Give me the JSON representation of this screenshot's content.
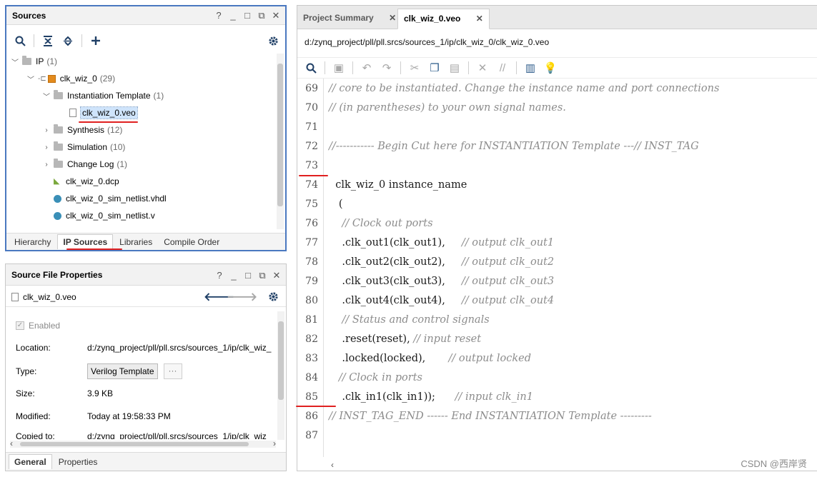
{
  "sources_panel": {
    "title": "Sources",
    "window_buttons": [
      "?",
      "_",
      "□",
      "⧉",
      "✕"
    ],
    "toolbar": [
      "search-icon",
      "collapse-all-icon",
      "expand-all-icon",
      "add-icon",
      "gear-icon"
    ],
    "tree": [
      {
        "label": "IP",
        "count": "(1)"
      },
      {
        "label": "clk_wiz_0",
        "count": "(29)"
      },
      {
        "label": "Instantiation Template",
        "count": "(1)"
      },
      {
        "label": "clk_wiz_0.veo",
        "count": ""
      },
      {
        "label": "Synthesis",
        "count": "(12)"
      },
      {
        "label": "Simulation",
        "count": "(10)"
      },
      {
        "label": "Change Log",
        "count": "(1)"
      },
      {
        "label": "clk_wiz_0.dcp",
        "count": ""
      },
      {
        "label": "clk_wiz_0_sim_netlist.vhdl",
        "count": ""
      },
      {
        "label": "clk_wiz_0_sim_netlist.v",
        "count": ""
      }
    ],
    "tabs": [
      "Hierarchy",
      "IP Sources",
      "Libraries",
      "Compile Order"
    ]
  },
  "properties_panel": {
    "title": "Source File Properties",
    "window_buttons": [
      "?",
      "_",
      "□",
      "⧉",
      "✕"
    ],
    "file": "clk_wiz_0.veo",
    "enabled_label": "Enabled",
    "rows": [
      {
        "key": "Location:",
        "value": "d:/zynq_project/pll/pll.srcs/sources_1/ip/clk_wiz_"
      },
      {
        "key": "Type:",
        "value": "Verilog Template"
      },
      {
        "key": "Size:",
        "value": "3.9 KB"
      },
      {
        "key": "Modified:",
        "value": "Today at 19:58:33 PM"
      },
      {
        "key": "Copied to:",
        "value": "d:/zynq_project/pll/pll.srcs/sources_1/ip/clk_wiz"
      }
    ],
    "more_button": "···",
    "tabs": [
      "General",
      "Properties"
    ]
  },
  "editor": {
    "tabs": [
      {
        "label": "Project Summary",
        "close": "✕"
      },
      {
        "label": "clk_wiz_0.veo",
        "close": "✕"
      }
    ],
    "path": "d:/zynq_project/pll/pll.srcs/sources_1/ip/clk_wiz_0/clk_wiz_0.veo",
    "lines": [
      {
        "n": "69",
        "code": "",
        "comment": "// core to be instantiated. Change the instance name and port connections"
      },
      {
        "n": "70",
        "code": "",
        "comment": "// (in parentheses) to your own signal names."
      },
      {
        "n": "71",
        "code": "",
        "comment": ""
      },
      {
        "n": "72",
        "code": "",
        "comment": "//----------- Begin Cut here for INSTANTIATION Template ---// INST_TAG"
      },
      {
        "n": "73",
        "code": "",
        "comment": ""
      },
      {
        "n": "74",
        "code": "  clk_wiz_0 instance_name",
        "comment": ""
      },
      {
        "n": "75",
        "code": "   (",
        "comment": ""
      },
      {
        "n": "76",
        "code": "    ",
        "comment": "// Clock out ports"
      },
      {
        "n": "77",
        "code": "    .clk_out1(clk_out1),     ",
        "comment": "// output clk_out1"
      },
      {
        "n": "78",
        "code": "    .clk_out2(clk_out2),     ",
        "comment": "// output clk_out2"
      },
      {
        "n": "79",
        "code": "    .clk_out3(clk_out3),     ",
        "comment": "// output clk_out3"
      },
      {
        "n": "80",
        "code": "    .clk_out4(clk_out4),     ",
        "comment": "// output clk_out4"
      },
      {
        "n": "81",
        "code": "    ",
        "comment": "// Status and control signals"
      },
      {
        "n": "82",
        "code": "    .reset(reset), ",
        "comment": "// input reset"
      },
      {
        "n": "83",
        "code": "    .locked(locked),       ",
        "comment": "// output locked"
      },
      {
        "n": "84",
        "code": "   ",
        "comment": "// Clock in ports"
      },
      {
        "n": "85",
        "code": "    .clk_in1(clk_in1));      ",
        "comment": "// input clk_in1"
      },
      {
        "n": "86",
        "code": "",
        "comment": "// INST_TAG_END ------ End INSTANTIATION Template ---------"
      },
      {
        "n": "87",
        "code": "",
        "comment": ""
      }
    ]
  },
  "watermark": "CSDN @西岸贤",
  "colors": {
    "accent": "#3a6fb0",
    "annotation": "#e02020",
    "comment": "#8c8c8c"
  }
}
